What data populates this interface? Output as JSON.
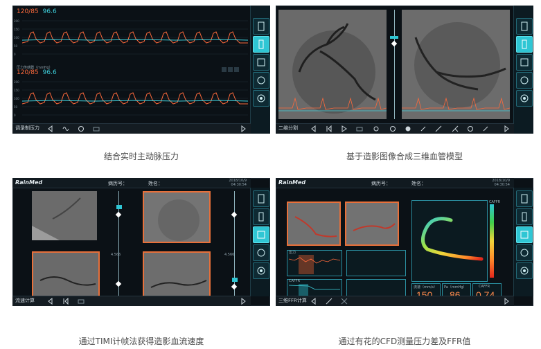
{
  "captions": {
    "c1": "结合实时主动脉压力",
    "c2": "基于造影图像合成三维血管模型",
    "c3": "通过TIMI计帧法获得造影血流速度",
    "c4": "通过有花的CFD测量压力差及FFR值"
  },
  "panel1": {
    "top_bp": "120/85",
    "top_spo2": "96.6",
    "mid_bp": "120/85",
    "mid_spo2": "96.6",
    "mid_sublabel": "压力传感器（mmHg）",
    "bottom_label": "调录制压力"
  },
  "panel2": {
    "bottom_label": "二维分割"
  },
  "panel3": {
    "logo": "RainMed",
    "patient_id_label": "病历号：",
    "name_label": "姓名：",
    "date": "2018/10/9",
    "time": "04:30:54",
    "bottom_label": "流速计算",
    "left_mid_label": "4.566",
    "right_mid_label": "4.566"
  },
  "panel4": {
    "logo": "RainMed",
    "patient_id_label": "病历号：",
    "name_label": "姓名：",
    "date": "2018/10/9",
    "time": "04:30:54",
    "bottom_label": "三维FFR计算",
    "chart_label_top": "压力",
    "chart_label_bottom": "CAFFR",
    "cfr_label": "CAFFR",
    "flow_label": "流速（mm/s）",
    "flow_value": "150",
    "pd_label": "Pa（mmHg）",
    "pd_value": "86",
    "ffr_label": "CAFFR",
    "ffr_value": "0.74"
  },
  "colors": {
    "accent": "#2fc6d4",
    "pressure": "#ff6a3c",
    "spo2": "#3fd4e0",
    "frame": "#e8703a"
  },
  "icons": {
    "right_bar": [
      "document-icon",
      "ruler-icon",
      "chart-icon",
      "clock-icon",
      "target-icon"
    ]
  }
}
